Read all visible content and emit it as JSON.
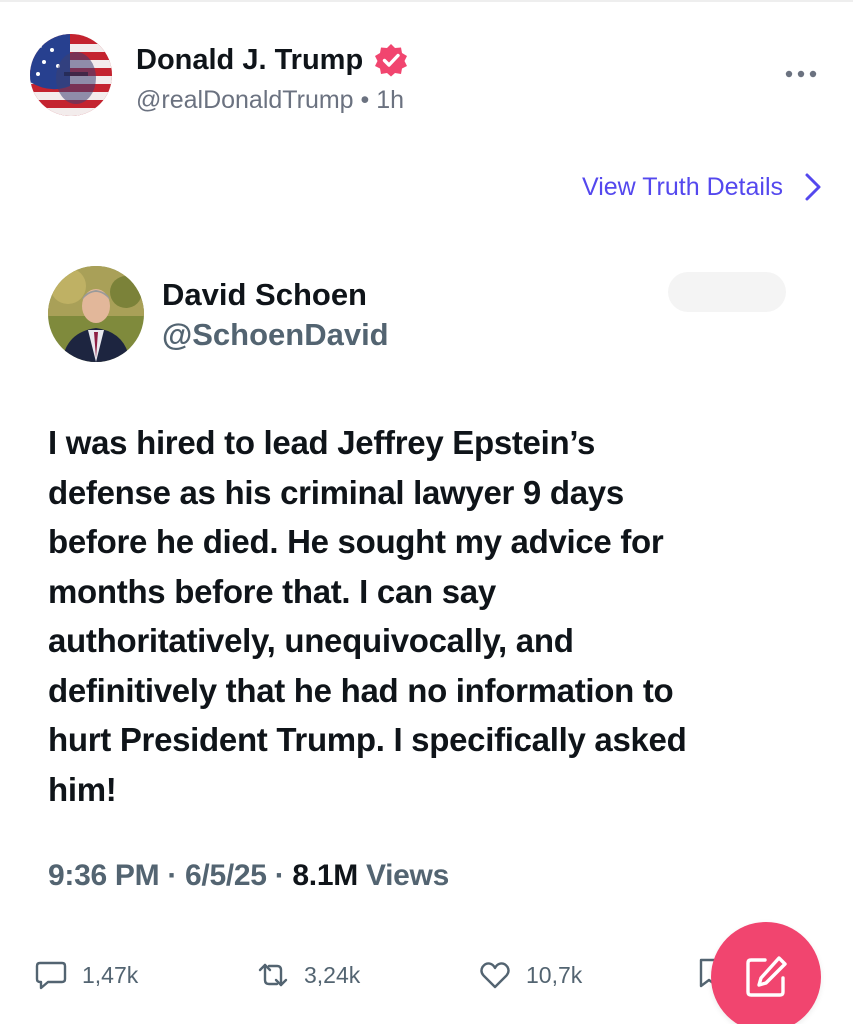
{
  "post": {
    "author_name": "Donald J. Trump",
    "handle_time": "@realDonaldTrump • 1h",
    "details_link": "View Truth Details"
  },
  "tweet": {
    "author_name": "David Schoen",
    "handle": "@SchoenDavid",
    "body_lines": [
      "I was hired to lead Jeffrey Epstein’s",
      "defense as his criminal lawyer 9 days",
      "before he died.  He sought my advice for",
      "months before that.  I can say",
      "authoritatively, unequivocally, and",
      "definitively that he had no information to",
      "hurt President Trump.  I specifically asked",
      "him!"
    ],
    "time": "9:36 PM",
    "date": "6/5/25",
    "views_count": "8.1M",
    "views_label": "Views"
  },
  "actions": {
    "replies": "1,47k",
    "retruths": "3,24k",
    "likes": "10,7k"
  },
  "icons": {
    "verified": "verified-badge-icon",
    "more": "more-icon",
    "chevron": "chevron-right-icon",
    "reply": "reply-icon",
    "retruth": "retruth-icon",
    "like": "heart-icon",
    "bookmark": "bookmark-icon",
    "compose": "compose-icon"
  },
  "colors": {
    "accent_link": "#5448ee",
    "verified_badge": "#f1456f",
    "compose_button": "#f1456f",
    "muted_text": "#6b7280"
  }
}
